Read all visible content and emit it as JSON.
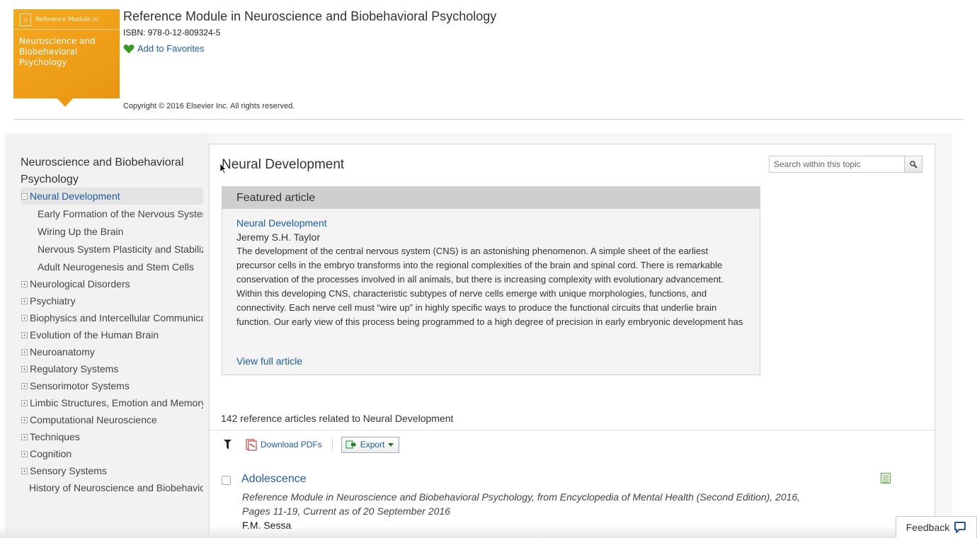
{
  "cover": {
    "series": "Reference Module in",
    "title": "Neuroscience and Biobehavioral Psychology",
    "color": "#f0a018"
  },
  "header": {
    "book_title": "Reference Module in Neuroscience and Biobehavioral Psychology",
    "isbn": "ISBN: 978-0-12-809324-5",
    "favorites_label": "Add to Favorites",
    "favorites_icon": "heart-icon",
    "copyright": "Copyright © 2016 Elsevier Inc. All rights reserved."
  },
  "sidebar": {
    "title": "Neuroscience and Biobehavioral Psychology",
    "items": [
      {
        "label": "Neural Development",
        "toggle": "−",
        "active": true
      },
      {
        "label": "Early Formation of the Nervous System",
        "sub": true
      },
      {
        "label": "Wiring Up the Brain",
        "sub": true
      },
      {
        "label": "Nervous System Plasticity and Stabiliza",
        "sub": true
      },
      {
        "label": "Adult Neurogenesis and Stem Cells",
        "sub": true
      },
      {
        "label": "Neurological Disorders",
        "toggle": "+"
      },
      {
        "label": "Psychiatry",
        "toggle": "+"
      },
      {
        "label": "Biophysics and Intercellular Communicati",
        "toggle": "+"
      },
      {
        "label": "Evolution of the Human Brain",
        "toggle": "+"
      },
      {
        "label": "Neuroanatomy",
        "toggle": "+"
      },
      {
        "label": "Regulatory Systems",
        "toggle": "+"
      },
      {
        "label": "Sensorimotor Systems",
        "toggle": "+"
      },
      {
        "label": "Limbic Structures, Emotion and Memory",
        "toggle": "+"
      },
      {
        "label": "Computational Neuroscience",
        "toggle": "+"
      },
      {
        "label": "Techniques",
        "toggle": "+"
      },
      {
        "label": "Cognition",
        "toggle": "+"
      },
      {
        "label": "Sensory Systems",
        "toggle": "+"
      },
      {
        "label": "History of Neuroscience and Biobehaviora"
      }
    ]
  },
  "main": {
    "topic_title": "Neural Development",
    "search": {
      "placeholder": "Search within this topic"
    },
    "featured": {
      "heading": "Featured article",
      "article_title": "Neural Development",
      "author": "Jeremy S.H. Taylor",
      "abstract": "The development of the central nervous system (CNS) is an astonishing phenomenon. A simple sheet of the earliest precursor cells in the embryo transforms into the regional complexities of the brain and spinal cord. There is remarkable conservation of the processes involved in all animals, but there is increasing complexity with evolutionary advancement. Within this developing CNS, characteristic subtypes of nerve cells emerge with unique morphologies, functions, and connectivity. Each nerve cell must “wire up” in highly specific ways to produce the functional circuits that underlie brain function. Our early view of this process being programmed to a high degree of precision in early embryonic development has been changed by evidence for a far less rigorous process, where errors are made, nerve cells are eliminated, and",
      "view_full": "View full article"
    },
    "count_text": "142 reference articles related to Neural Development",
    "toolbar": {
      "download_label": "Download PDFs",
      "export_label": "Export"
    },
    "results": [
      {
        "title": "Adolescence",
        "source": "Reference Module in Neuroscience and Biobehavioral Psychology, from Encyclopedia of Mental Health (Second Edition), 2016, Pages 11-19, Current as of 20 September 2016",
        "author": "F.M. Sessa"
      }
    ]
  },
  "feedback": {
    "label": "Feedback"
  },
  "colors": {
    "link": "#1f5b9f",
    "accent": "#f0a018",
    "heart": "#3a9a2a"
  }
}
